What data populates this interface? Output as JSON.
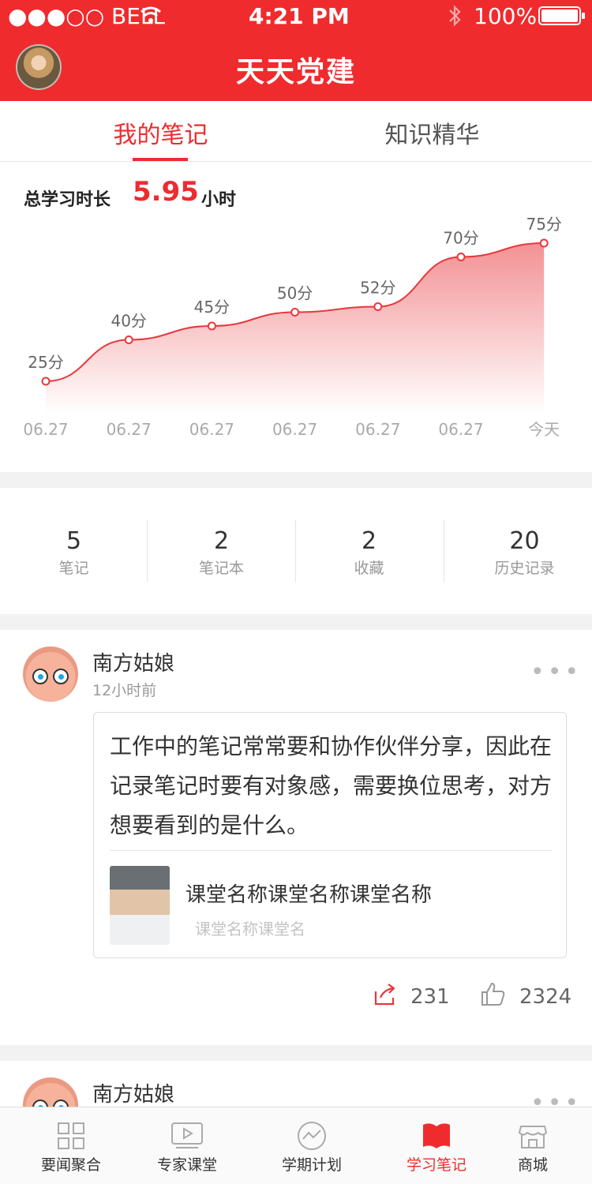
{
  "status_bar": {
    "carrier": "●●●○○ BELL",
    "time": "4:21 PM",
    "battery": "100%"
  },
  "header": {
    "title": "天天党建"
  },
  "tabs": [
    {
      "label": "我的笔记",
      "active": true
    },
    {
      "label": "知识精华",
      "active": false
    }
  ],
  "study": {
    "label": "总学习时长",
    "value": "5.95",
    "unit": "小时"
  },
  "chart_data": {
    "type": "area",
    "categories": [
      "06.27",
      "06.27",
      "06.27",
      "06.27",
      "06.27",
      "06.27",
      "今天"
    ],
    "values": [
      25,
      40,
      45,
      50,
      52,
      70,
      75
    ],
    "value_labels": [
      "25分",
      "40分",
      "45分",
      "50分",
      "52分",
      "70分",
      "75分"
    ],
    "color": "#e8383d"
  },
  "stats": [
    {
      "value": "5",
      "label": "笔记"
    },
    {
      "value": "2",
      "label": "笔记本"
    },
    {
      "value": "2",
      "label": "收藏"
    },
    {
      "value": "20",
      "label": "历史记录"
    }
  ],
  "post": {
    "author": "南方姑娘",
    "time": "12小时前",
    "more": "•••",
    "content": "工作中的笔记常常要和协作伙伴分享，因此在记录笔记时要有对象感，需要换位思考，对方想要看到的是什么。",
    "course_title": "课堂名称课堂名称课堂名称",
    "course_sub": "课堂名称课堂名",
    "share_count": "231",
    "like_count": "2324"
  },
  "post2": {
    "author": "南方姑娘",
    "more": "•••"
  },
  "tabbar": [
    {
      "label": "要闻聚合",
      "icon": "grid-icon",
      "active": false
    },
    {
      "label": "专家课堂",
      "icon": "video-icon",
      "active": false
    },
    {
      "label": "学期计划",
      "icon": "trend-icon",
      "active": false
    },
    {
      "label": "学习笔记",
      "icon": "notebook-icon",
      "active": true
    },
    {
      "label": "商城",
      "icon": "store-icon",
      "active": false
    }
  ]
}
